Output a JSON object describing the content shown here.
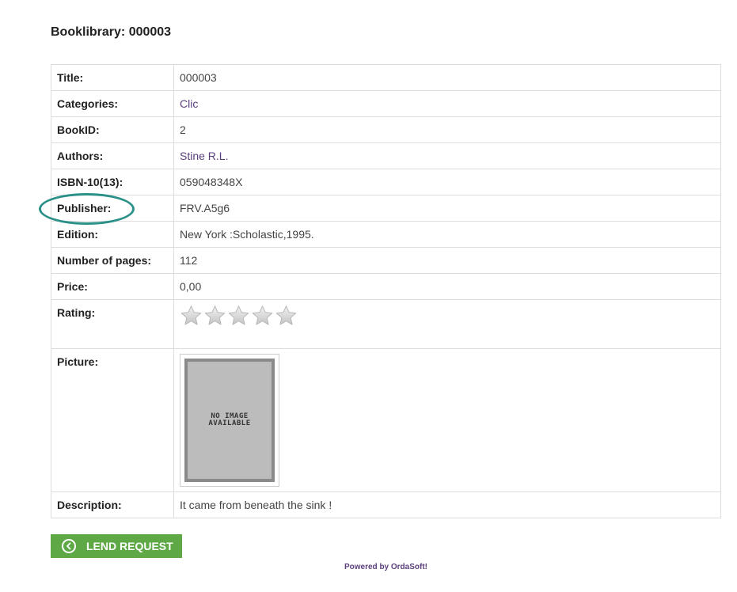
{
  "page": {
    "title": "Booklibrary: 000003"
  },
  "details": {
    "title_label": "Title:",
    "title_value": "000003",
    "categories_label": "Categories:",
    "categories_value": "Clic",
    "bookid_label": "BookID:",
    "bookid_value": "2",
    "authors_label": "Authors:",
    "authors_value": "Stine R.L.",
    "isbn_label": "ISBN-10(13):",
    "isbn_value": "059048348X",
    "publisher_label": "Publisher:",
    "publisher_value": "FRV.A5g6",
    "edition_label": "Edition:",
    "edition_value": "New York :Scholastic,1995.",
    "pages_label": "Number of pages:",
    "pages_value": "112",
    "price_label": "Price:",
    "price_value": "0,00",
    "rating_label": "Rating:",
    "rating_value": 0,
    "rating_max": 5,
    "picture_label": "Picture:",
    "picture_placeholder_line1": "NO IMAGE",
    "picture_placeholder_line2": "AVAILABLE",
    "description_label": "Description:",
    "description_value": "It came from beneath the sink !"
  },
  "actions": {
    "lend_request_label": "LEND REQUEST",
    "lend_icon": "chevron-left-circle-icon"
  },
  "footer": {
    "powered_by": "Powered by OrdaSoft!"
  },
  "colors": {
    "link": "#5b3f7c",
    "button": "#5ea946",
    "highlight": "#2a9088",
    "star_empty": "#d8d8d8"
  }
}
